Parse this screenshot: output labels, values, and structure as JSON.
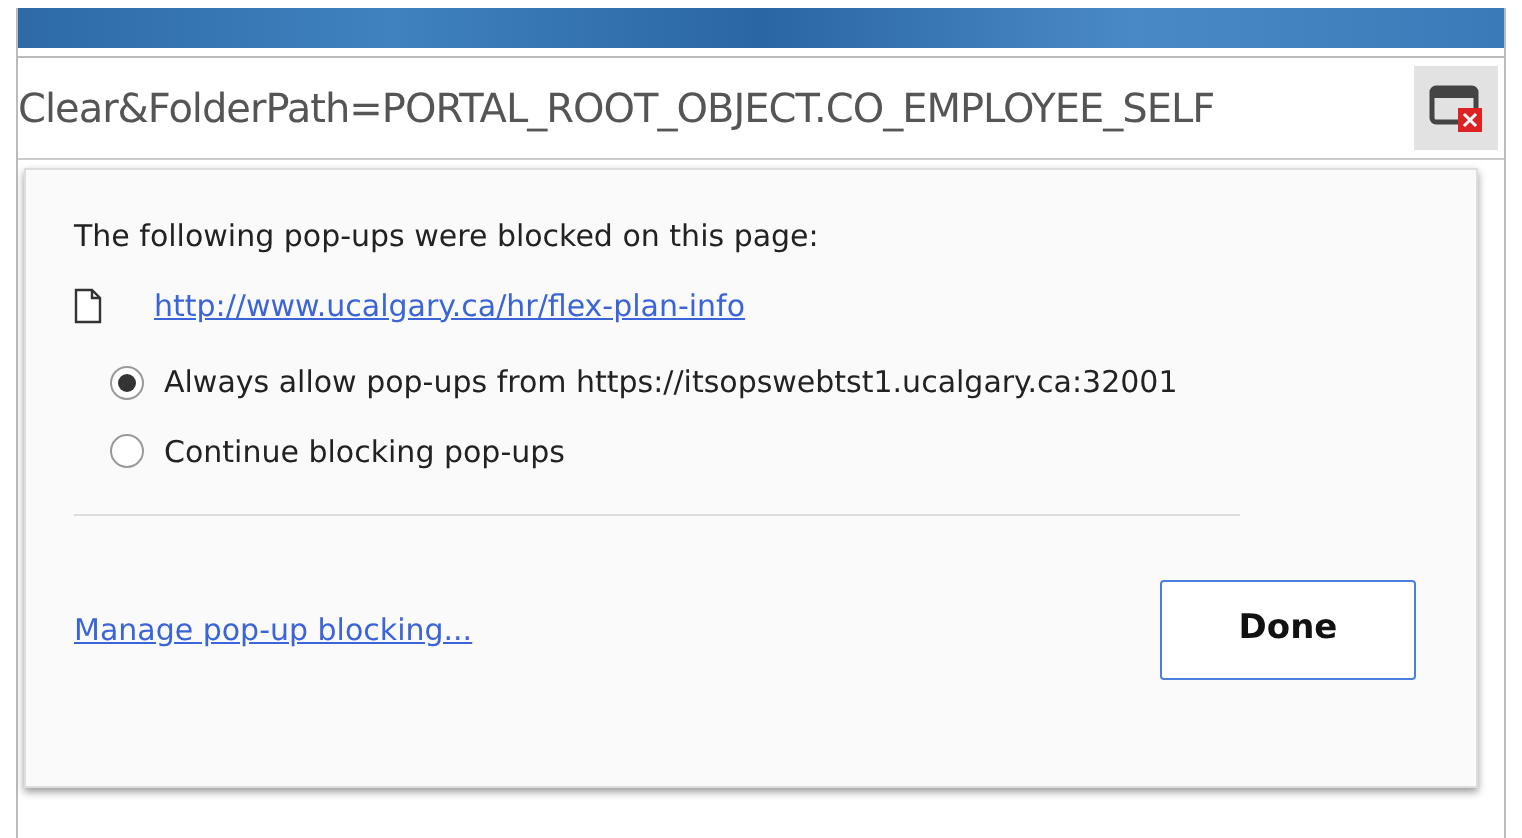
{
  "address_bar": {
    "url": "Clear&FolderPath=PORTAL_ROOT_OBJECT.CO_EMPLOYEE_SELF"
  },
  "popup": {
    "heading": "The following pop-ups were blocked on this page:",
    "blocked": [
      {
        "url": "http://www.ucalgary.ca/hr/flex-plan-info"
      }
    ],
    "options": [
      {
        "label": "Always allow pop-ups from https://itsopswebtst1.ucalgary.ca:32001",
        "selected": true
      },
      {
        "label": "Continue blocking pop-ups",
        "selected": false
      }
    ],
    "manage_link": "Manage pop-up blocking...",
    "done_button": "Done"
  }
}
